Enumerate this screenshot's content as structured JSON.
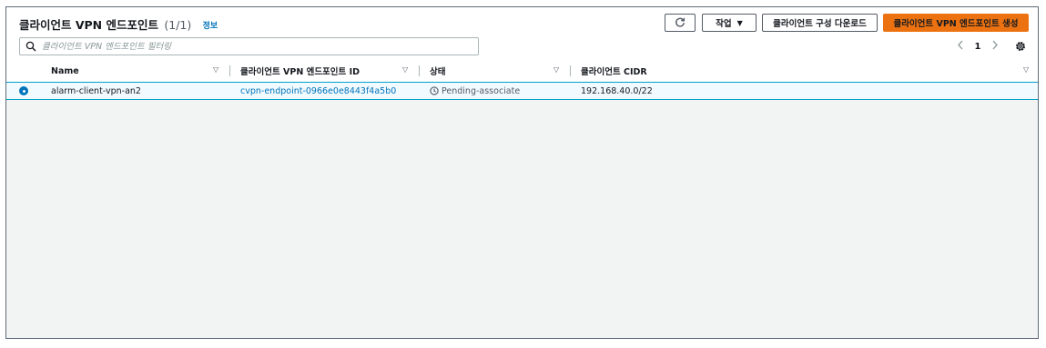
{
  "header": {
    "title": "클라이언트 VPN 엔드포인트",
    "count": "(1/1)",
    "info_link": "정보"
  },
  "toolbar": {
    "refresh_icon": "refresh-icon",
    "actions_label": "작업",
    "download_label": "클라이언트 구성 다운로드",
    "create_label": "클라이언트 VPN 엔드포인트 생성",
    "primary_color": "#ec7211"
  },
  "search": {
    "placeholder": "클라이언트 VPN 엔드포인트 필터링",
    "value": ""
  },
  "pagination": {
    "prev_icon": "chevron-left-icon",
    "current_page": "1",
    "next_icon": "chevron-right-icon",
    "settings_icon": "gear-icon"
  },
  "table": {
    "columns": [
      "Name",
      "클라이언트 VPN 엔드포인트 ID",
      "상태",
      "클라이언트 CIDR"
    ],
    "rows": [
      {
        "selected": true,
        "name": "alarm-client-vpn-an2",
        "endpoint_id": "cvpn-endpoint-0966e0e8443f4a5b0",
        "status": "Pending-associate",
        "cidr": "192.168.40.0/22"
      }
    ]
  },
  "colors": {
    "link": "#0073bb",
    "selected_row_bg": "#f1faff",
    "selected_row_border": "#00a1c9"
  }
}
